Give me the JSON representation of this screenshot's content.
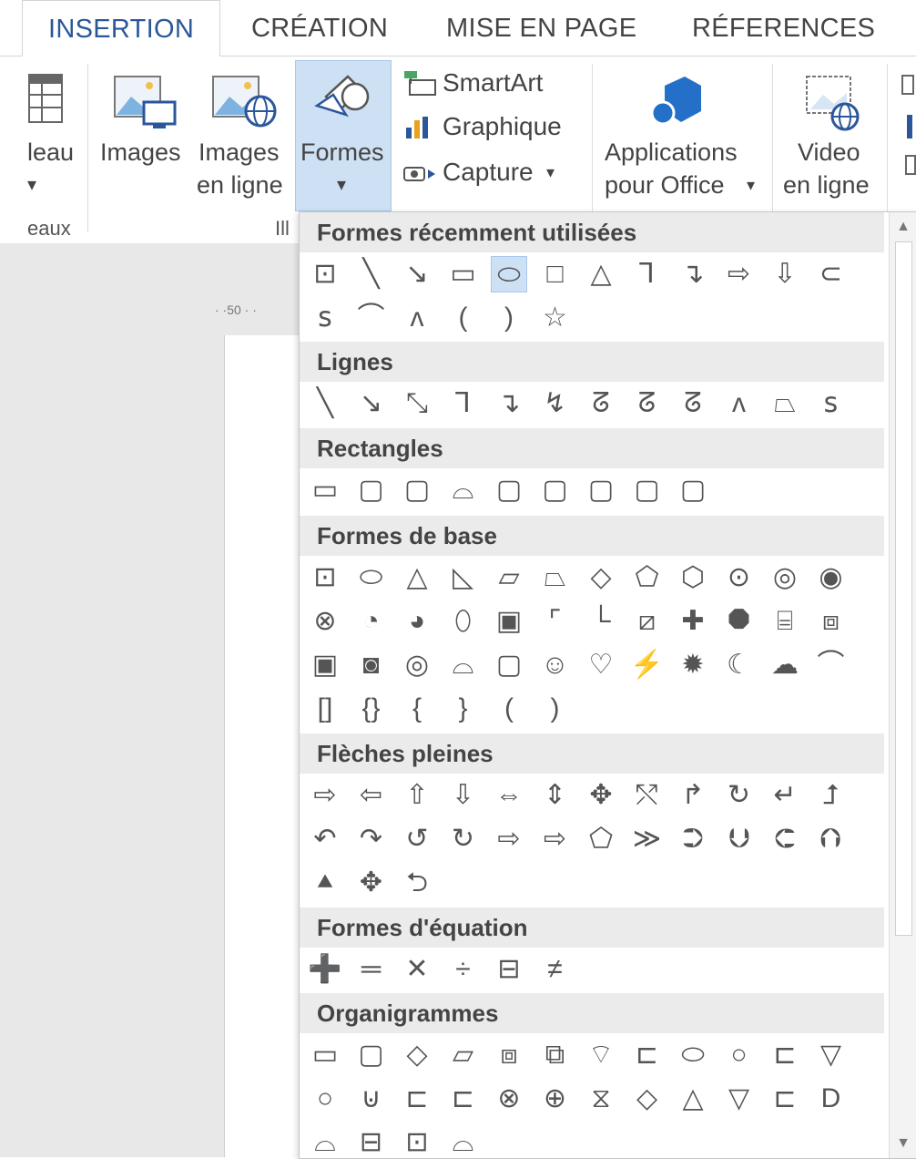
{
  "tabs": [
    "INSERTION",
    "CRÉATION",
    "MISE EN PAGE",
    "RÉFERENCES"
  ],
  "ribbon": {
    "tableau_label": "leau",
    "images_label": "Images",
    "images_en_ligne_label": [
      "Images",
      "en ligne"
    ],
    "formes_label": "Formes",
    "smartart_label": "SmartArt",
    "graphique_label": "Graphique",
    "capture_label": "Capture",
    "applications_label": [
      "Applications",
      "pour Office"
    ],
    "video_label": [
      "Video",
      "en ligne"
    ],
    "group_left": "eaux",
    "group_mid": "Ill"
  },
  "ruler_text": "· ·50 · ·",
  "accent_color": "#2b579a",
  "sections": [
    {
      "title": "Formes récemment utilisées",
      "rows": [
        [
          "⊡",
          "╲",
          "↘",
          "▭",
          "⬭",
          "□",
          "△",
          "⅂",
          "↴",
          "⇨",
          "⇩",
          "⊂"
        ],
        [
          "ꜱ",
          "⌒",
          "ᴧ",
          "(",
          ")",
          "☆"
        ]
      ]
    },
    {
      "title": "Lignes",
      "rows": [
        [
          "╲",
          "↘",
          "⤡",
          "⅂",
          "↴",
          "↯",
          "ᘔ",
          "ᘔ",
          "ᘔ",
          "ᴧ",
          "⏢",
          "ꜱ"
        ]
      ]
    },
    {
      "title": "Rectangles",
      "rows": [
        [
          "▭",
          "▢",
          "▢",
          "⌓",
          "▢",
          "▢",
          "▢",
          "▢",
          "▢"
        ]
      ]
    },
    {
      "title": "Formes de base",
      "rows": [
        [
          "⊡",
          "⬭",
          "△",
          "◺",
          "▱",
          "⏢",
          "◇",
          "⬠",
          "⬡",
          "⊙",
          "◎",
          "◉"
        ],
        [
          "⊗",
          "◔",
          "◕",
          "⬯",
          "▣",
          "⌜",
          "└",
          "⧄",
          "✚",
          "⯃",
          "⌸",
          "⧈"
        ],
        [
          "▣",
          "◙",
          "◎",
          "⌓",
          "▢",
          "☺",
          "♡",
          "⚡",
          "✹",
          "☾",
          "☁",
          "⌒"
        ],
        [
          "[]",
          "{}",
          "{",
          "}",
          "(",
          ")"
        ]
      ]
    },
    {
      "title": "Flèches pleines",
      "rows": [
        [
          "⇨",
          "⇦",
          "⇧",
          "⇩",
          "⇔",
          "⇕",
          "✥",
          "⤲",
          "↱",
          "↻",
          "↵",
          "⮥"
        ],
        [
          "↶",
          "↷",
          "↺",
          "↻",
          "⇨",
          "⇨",
          "⬠",
          "≫",
          "⮊",
          "⮋",
          "⮈",
          "⮉"
        ],
        [
          "⯅",
          "✥",
          "⮌"
        ]
      ]
    },
    {
      "title": "Formes d'équation",
      "rows": [
        [
          "➕",
          "═",
          "✕",
          "÷",
          "⊟",
          "≠"
        ]
      ]
    },
    {
      "title": "Organigrammes",
      "rows": [
        [
          "▭",
          "▢",
          "◇",
          "▱",
          "⧈",
          "⧉",
          "⌔",
          "⊏",
          "⬭",
          "○",
          "⊏",
          "▽"
        ],
        [
          "○",
          "⊍",
          "⊏",
          "⊏",
          "⊗",
          "⊕",
          "⧖",
          "◇",
          "△",
          "▽",
          "⊏",
          "D"
        ],
        [
          "⌓",
          "⊟",
          "⊡",
          "⌓"
        ]
      ]
    }
  ]
}
